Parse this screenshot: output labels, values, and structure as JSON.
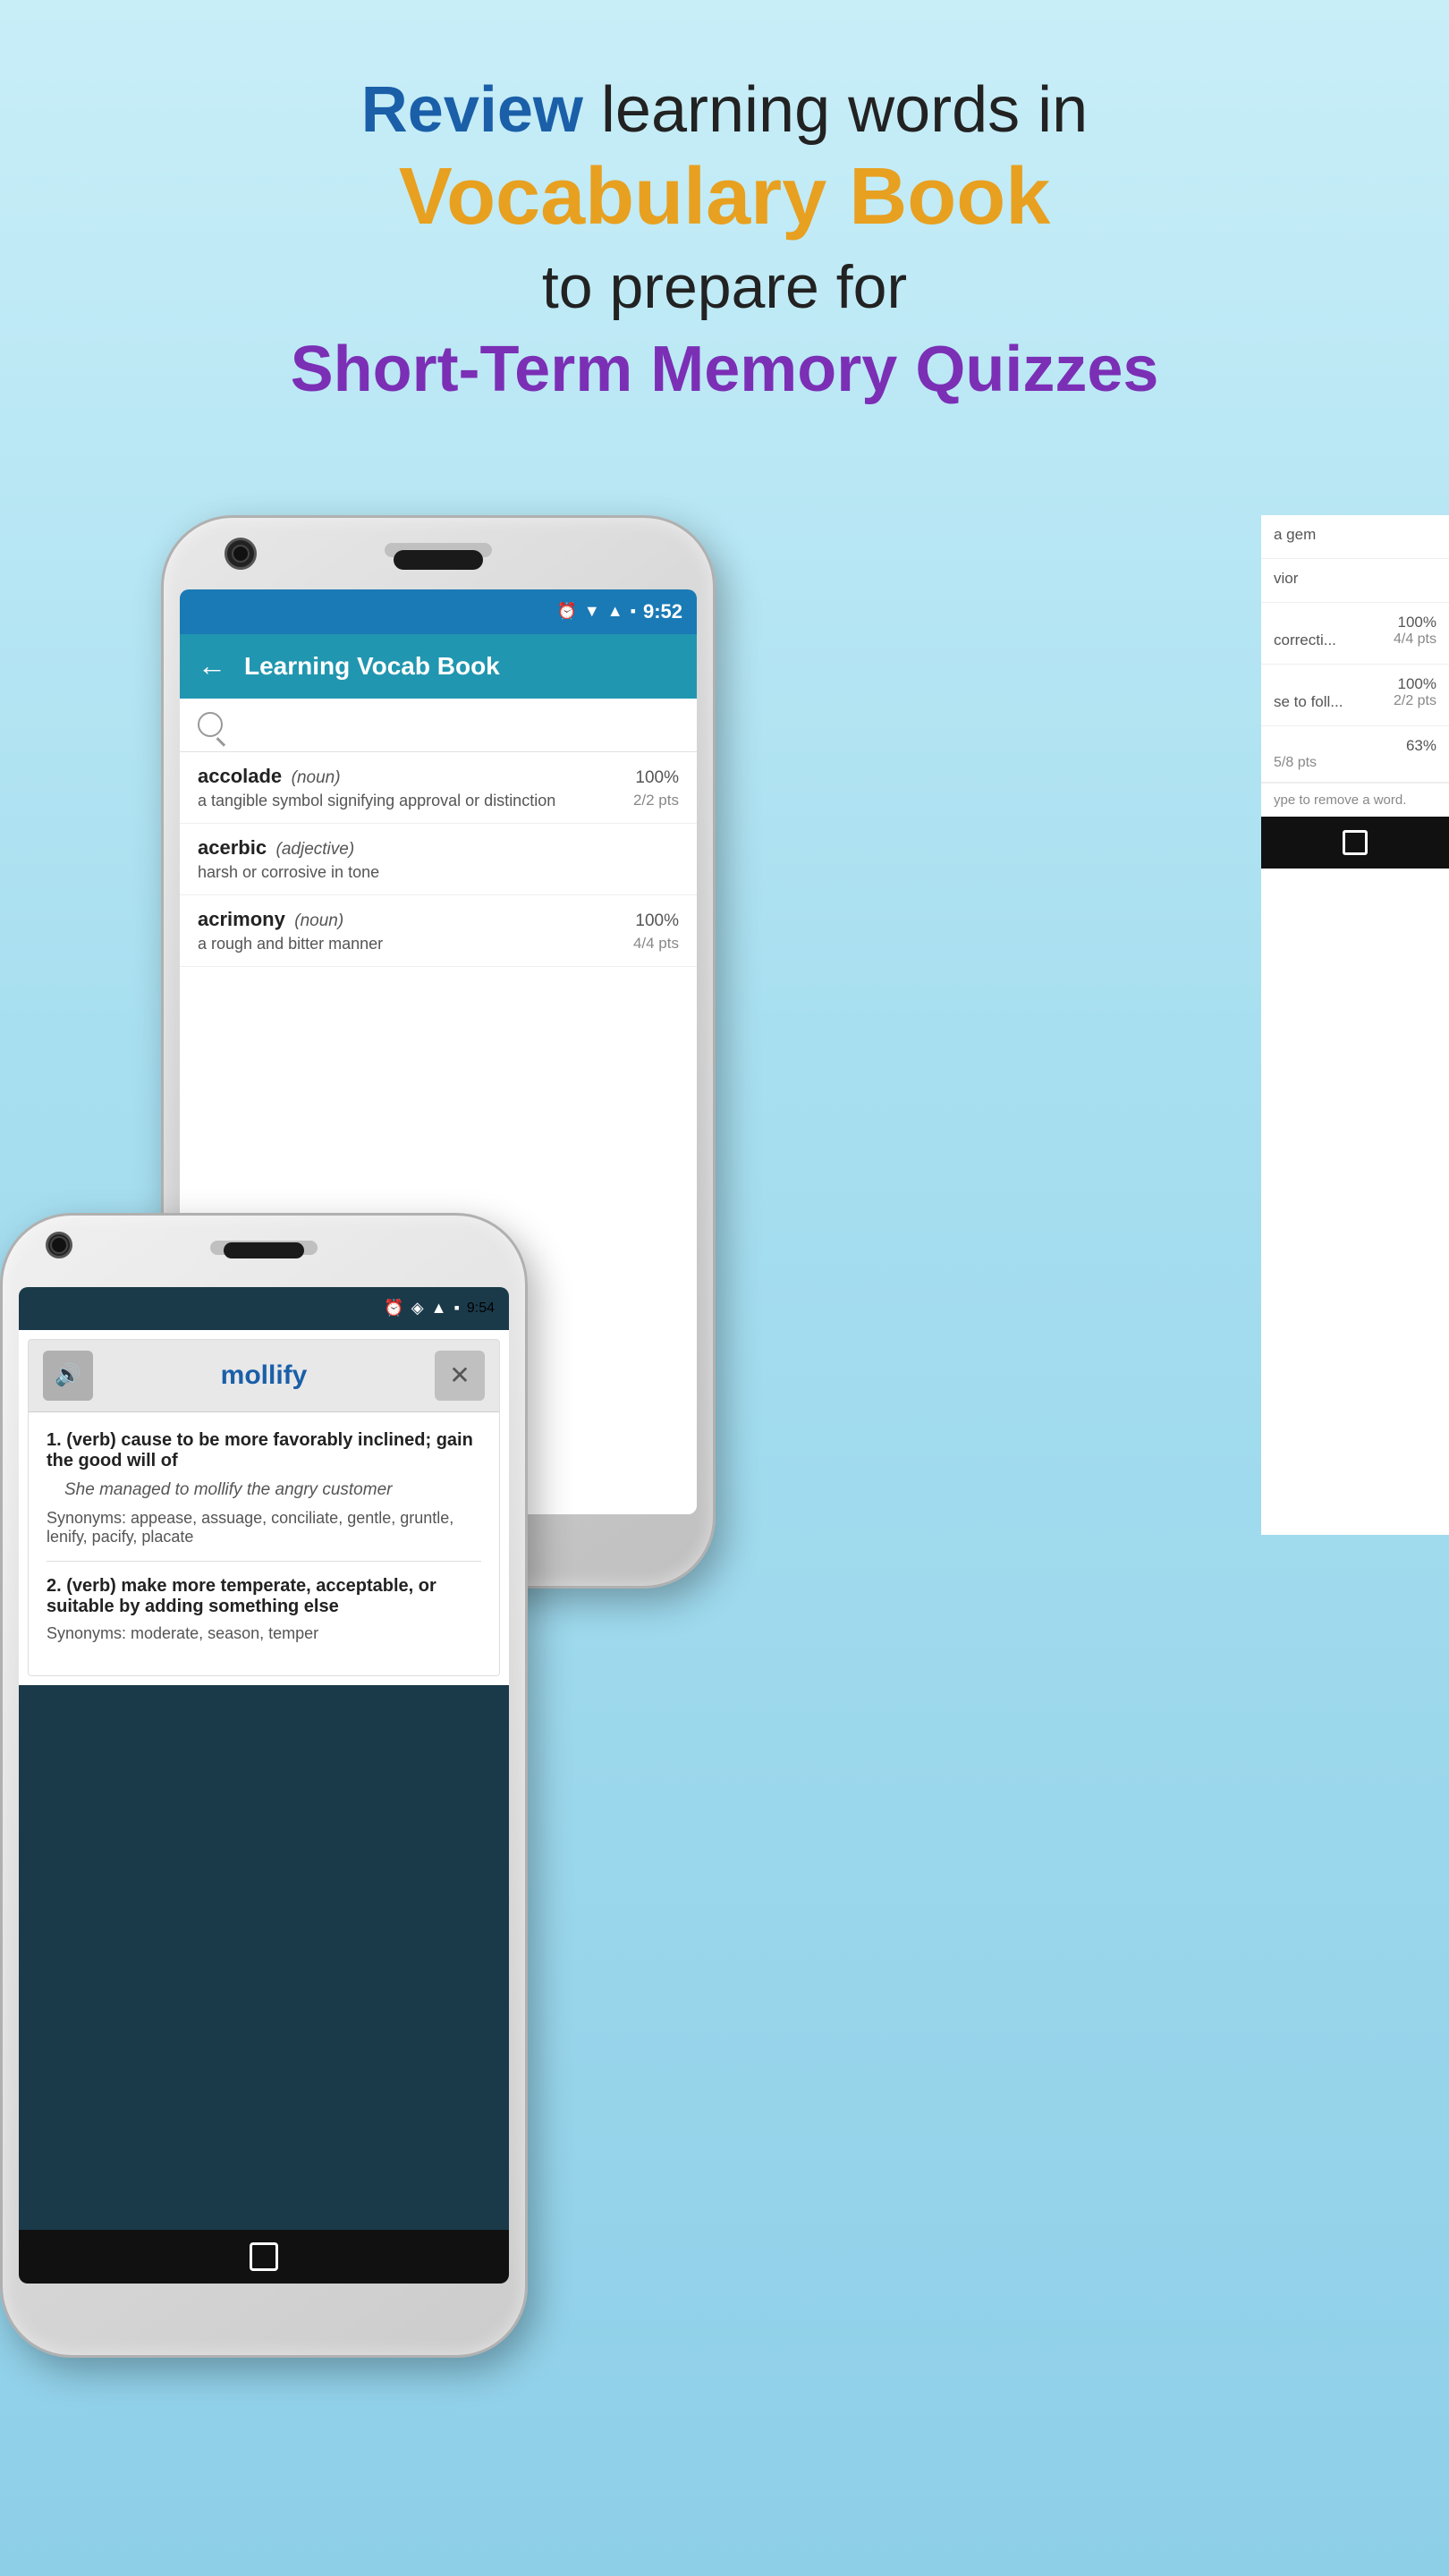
{
  "header": {
    "line1_bold": "Review",
    "line1_rest": " learning words in",
    "line2": "Vocabulary Book",
    "line3": "to prepare for",
    "line4": "Short-Term Memory Quizzes"
  },
  "back_phone": {
    "status_bar": {
      "time": "9:52",
      "icons": [
        "alarm",
        "wifi",
        "signal",
        "battery"
      ]
    },
    "app_bar": {
      "title": "Learning Vocab Book",
      "back_label": "←"
    },
    "search_placeholder": "Search...",
    "words": [
      {
        "word": "accolade",
        "pos": "(noun)",
        "percent": "100%",
        "definition": "a tangible symbol signifying approval or distinction",
        "pts": "2/2 pts"
      },
      {
        "word": "acerbic",
        "pos": "(adjective)",
        "percent": "",
        "definition": "harsh or corrosive in tone",
        "pts": ""
      },
      {
        "word": "acrimony",
        "pos": "(noun)",
        "percent": "100%",
        "definition": "a rough and bitter manner",
        "pts": "4/4 pts"
      }
    ],
    "partial_words": [
      {
        "text": "a gem",
        "percent": "",
        "pts": ""
      },
      {
        "text": "vior",
        "percent": "",
        "pts": ""
      },
      {
        "text": "correcti...",
        "percent": "100%",
        "pts": "4/4 pts"
      },
      {
        "text": "se to foll...",
        "percent": "100%",
        "pts": "2/2 pts"
      },
      {
        "text": "",
        "percent": "63%",
        "pts": "5/8 pts"
      }
    ],
    "swipe_hint": "ype to remove a word."
  },
  "front_phone": {
    "status_bar": {
      "time": "9:54",
      "icons": [
        "alarm",
        "wifi",
        "signal",
        "battery"
      ]
    },
    "dialog": {
      "word": "mollify",
      "speaker_icon": "🔊",
      "close_icon": "✕",
      "definitions": [
        {
          "number": "1.",
          "text": "(verb) cause to be more favorably inclined; gain the good will of",
          "example": "She managed to mollify the angry customer",
          "synonyms": "Synonyms: appease, assuage, conciliate, gentle, gruntle, lenify, pacify, placate"
        },
        {
          "number": "2.",
          "text": "(verb) make more temperate, acceptable, or suitable by adding something else",
          "example": "",
          "synonyms": "Synonyms: moderate, season, temper"
        }
      ]
    },
    "nav": {
      "square_icon": "□"
    }
  },
  "colors": {
    "app_bar": "#2196b0",
    "status_bar": "#1a7ab5",
    "dark_status": "#1a3a4a",
    "review_color": "#1a5fa8",
    "vocab_color": "#e8a020",
    "quiz_color": "#7b2fb5",
    "word_color": "#1a5fa8"
  }
}
